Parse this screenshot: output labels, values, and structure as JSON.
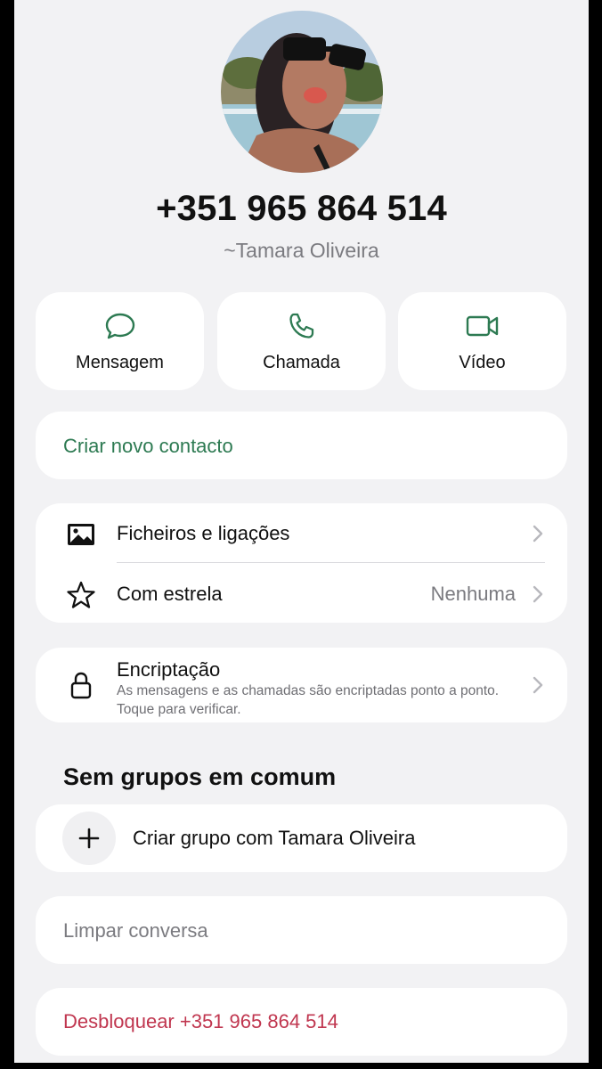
{
  "contact": {
    "phone": "+351 965 864 514",
    "display_name": "~Tamara Oliveira"
  },
  "actions": [
    {
      "label": "Mensagem",
      "icon": "message-icon"
    },
    {
      "label": "Chamada",
      "icon": "phone-icon"
    },
    {
      "label": "Vídeo",
      "icon": "video-icon"
    }
  ],
  "create_contact_label": "Criar novo contacto",
  "media_section": {
    "files_label": "Ficheiros e ligações",
    "starred_label": "Com estrela",
    "starred_value": "Nenhuma"
  },
  "encryption": {
    "title": "Encriptação",
    "description": "As mensagens e as chamadas são encriptadas ponto a ponto. Toque para verificar."
  },
  "groups": {
    "title": "Sem grupos em comum",
    "create_label": "Criar grupo com Tamara Oliveira"
  },
  "clear_chat_label": "Limpar conversa",
  "unblock_label": "Desbloquear +351 965 864 514",
  "colors": {
    "accent_green": "#2d7a52",
    "danger_red": "#c0364f",
    "background": "#f2f2f4",
    "card": "#ffffff"
  }
}
